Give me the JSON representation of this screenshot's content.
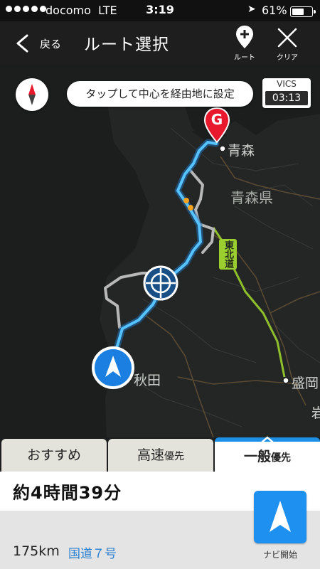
{
  "status_bar": {
    "carrier": "docomo",
    "network": "LTE",
    "time": "3:19",
    "battery": "61%",
    "battery_level": 0.61
  },
  "header": {
    "back_label": "戻る",
    "title": "ルート選択",
    "route_button_label": "ルート",
    "clear_button_label": "クリア"
  },
  "map": {
    "hint_text": "タップして中心を経由地に設定",
    "vics_label": "VICS",
    "vics_time": "03:13",
    "goal_marker": "G",
    "places": {
      "aomori_city": "青森",
      "aomori_pref": "青森県",
      "akita_city": "秋田",
      "morioka_city": "盛岡",
      "partial_label": "岩"
    },
    "road_label": "東北道",
    "colors": {
      "route": "#3ab4ff",
      "alt_route": "#b8b8b8",
      "goal": "#e8192c",
      "expressway": "#9bcf2f"
    }
  },
  "tabs": [
    {
      "label": "おすすめ",
      "suffix": "",
      "active": false
    },
    {
      "label": "高速",
      "suffix": "優先",
      "active": false
    },
    {
      "label": "一般",
      "suffix": "優先",
      "active": true
    }
  ],
  "summary": {
    "duration": "約4時間39分",
    "distance": "175km",
    "road": "国道７号",
    "nav_start_label": "ナビ開始"
  }
}
